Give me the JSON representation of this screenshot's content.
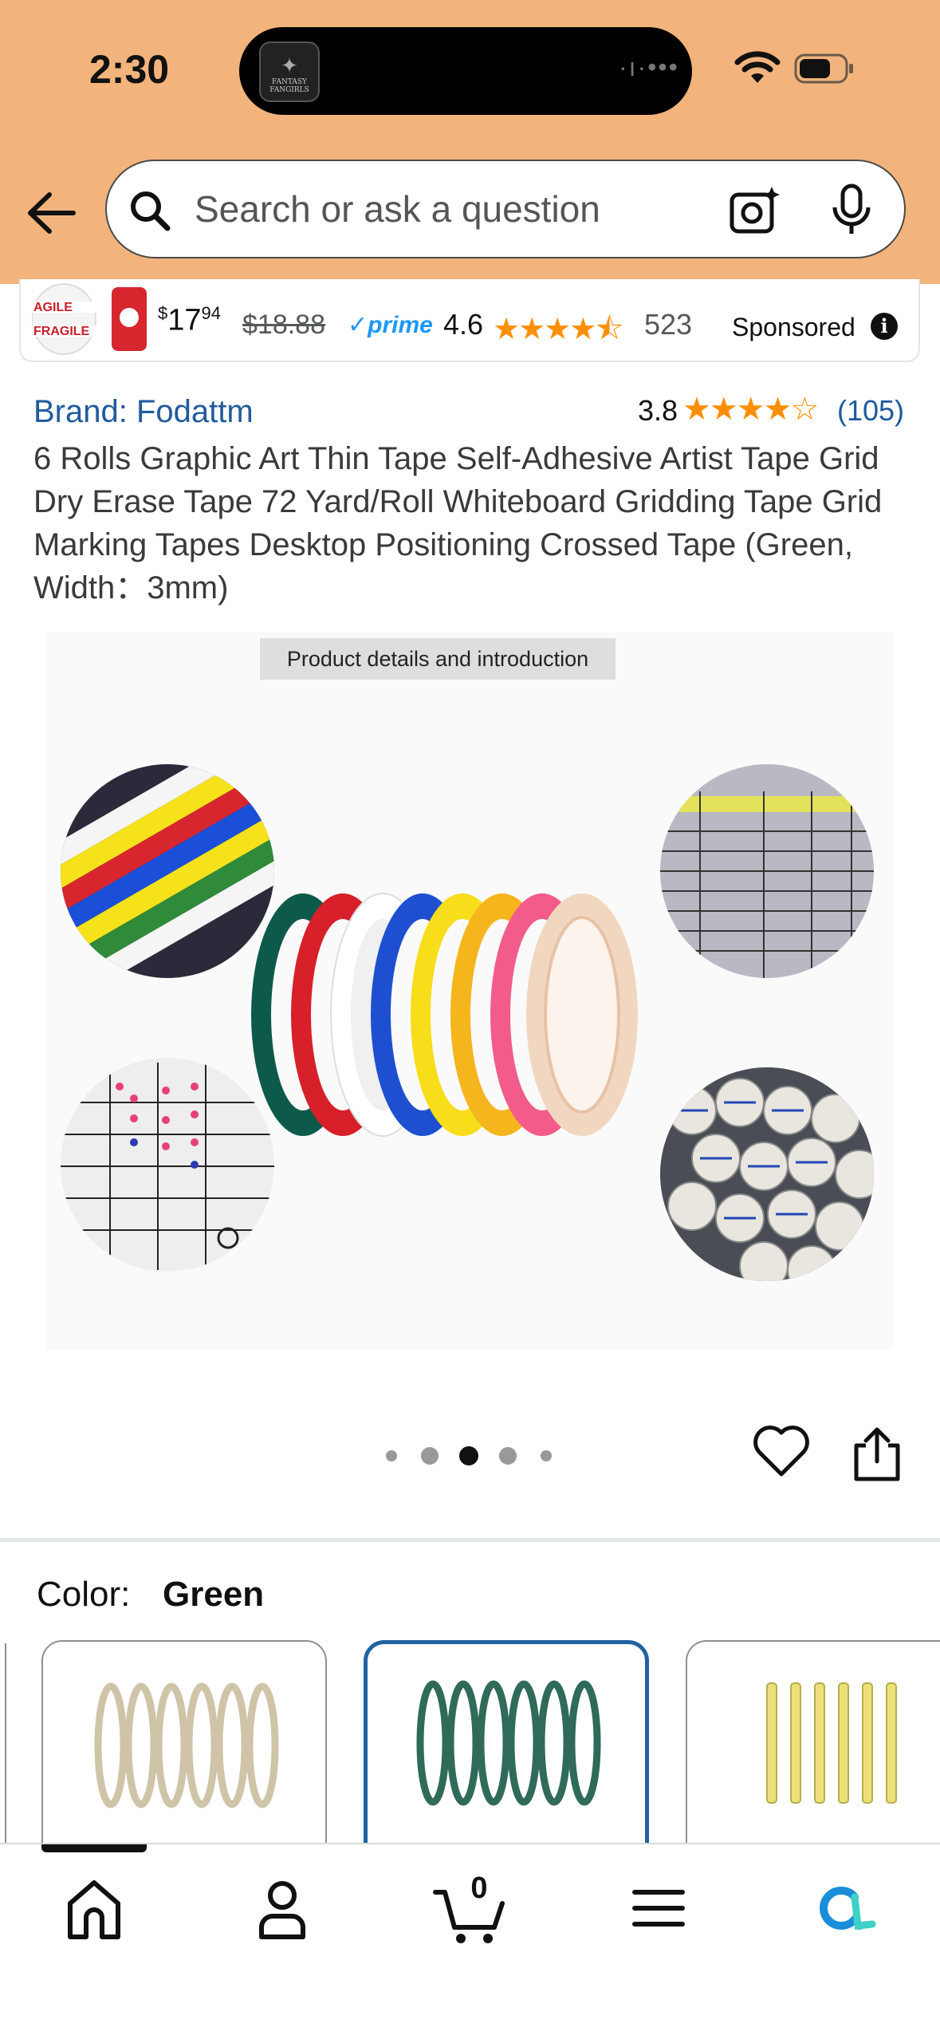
{
  "status_bar": {
    "time": "2:30",
    "island_app": "FANTASY FANGIRLS",
    "island_dots": "·ı·•••"
  },
  "search": {
    "placeholder": "Search or ask a question"
  },
  "sponsored_ad": {
    "price_currency": "$",
    "price_whole": "17",
    "price_fraction": "94",
    "old_price": "$18.88",
    "prime": "✓prime",
    "rating": "4.6",
    "stars": "★★★★⯪",
    "review_count": "523",
    "sponsored_label": "Sponsored",
    "info_icon": "i",
    "thumb_text_1": "AGILE",
    "thumb_text_2": "FRAGILE"
  },
  "product": {
    "brand": "Brand: Fodattm",
    "rating": "3.8",
    "stars": "★★★★☆",
    "review_count": "(105)",
    "title": "6 Rolls Graphic Art Thin Tape Self-Adhesive Artist Tape Grid Dry Erase Tape 72 Yard/Roll Whiteboard Gridding Tape Grid Marking Tapes Desktop Positioning Crossed Tape (Green, Width：3mm)"
  },
  "image": {
    "caption": "Product details and introduction",
    "carousel_total": 5,
    "carousel_active_index": 2
  },
  "variation": {
    "label": "Color:",
    "selected": "Green",
    "swatches": [
      {
        "name": "clear",
        "color": "#d8cfb8",
        "selected": false
      },
      {
        "name": "green",
        "color": "#2f6a5a",
        "selected": true
      },
      {
        "name": "yellow",
        "color": "#ece07a",
        "selected": false
      }
    ]
  },
  "nav": {
    "cart_count": "0",
    "items": [
      "home",
      "account",
      "cart",
      "menu",
      "rufus"
    ]
  },
  "colors": {
    "header_bg": "#f2b47c",
    "link": "#1f5a9e",
    "star": "#ff8f00",
    "selected_border": "#2162a1"
  }
}
